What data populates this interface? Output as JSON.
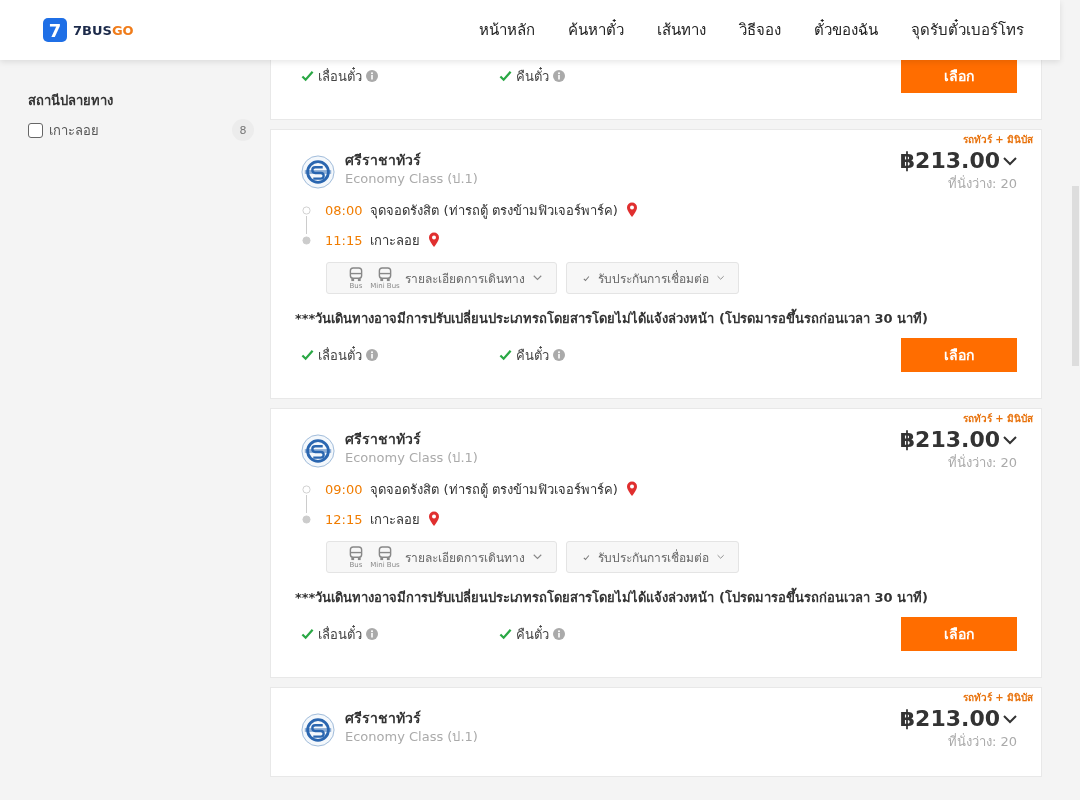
{
  "header": {
    "logo": {
      "mark": "7",
      "brand": "7BUS",
      "brand_accent": "GO"
    },
    "nav": [
      "หน้าหลัก",
      "ค้นหาตั๋ว",
      "เส้นทาง",
      "วิธีจอง",
      "ตั๋วของฉัน",
      "จุดรับตั๋วเบอร์โทร"
    ]
  },
  "sidebar": {
    "section_title": "สถานีปลายทาง",
    "filters": [
      {
        "label": "เกาะลอย",
        "count": "8",
        "checked": false
      }
    ]
  },
  "results": [
    {
      "kind": "foot_only",
      "features": [
        {
          "label": "เลื่อนตั๋ว",
          "available": true
        },
        {
          "label": "คืนตั๋ว",
          "available": true
        }
      ],
      "button": "เลือก"
    },
    {
      "kind": "full",
      "tag": "รถทัวร์ + มินิบัส",
      "operator": "ศรีราชาทัวร์",
      "class": "Economy Class (ป.1)",
      "price": "฿213.00",
      "seats": "ที่นั่งว่าง: 20",
      "stops": [
        {
          "time": "08:00",
          "place": "จุดจอดรังสิต (ท่ารถตู้ ตรงข้ามฟิวเจอร์พาร์ค)"
        },
        {
          "time": "11:15",
          "place": "เกาะลอย"
        }
      ],
      "vehicles": [
        "Bus",
        "Mini Bus"
      ],
      "details_label": "รายละเอียดการเดินทาง",
      "insurance_label": "รับประกันการเชื่อมต่อ",
      "notice": "***วันเดินทางอาจมีการปรับเปลี่ยนประเภทรถโดยสารโดยไม่ได้แจ้งล่วงหน้า (โปรดมารอขึ้นรถก่อนเวลา 30 นาที)",
      "features": [
        {
          "label": "เลื่อนตั๋ว",
          "available": true
        },
        {
          "label": "คืนตั๋ว",
          "available": true
        }
      ],
      "button": "เลือก"
    },
    {
      "kind": "full",
      "tag": "รถทัวร์ + มินิบัส",
      "operator": "ศรีราชาทัวร์",
      "class": "Economy Class (ป.1)",
      "price": "฿213.00",
      "seats": "ที่นั่งว่าง: 20",
      "stops": [
        {
          "time": "09:00",
          "place": "จุดจอดรังสิต (ท่ารถตู้ ตรงข้ามฟิวเจอร์พาร์ค)"
        },
        {
          "time": "12:15",
          "place": "เกาะลอย"
        }
      ],
      "vehicles": [
        "Bus",
        "Mini Bus"
      ],
      "details_label": "รายละเอียดการเดินทาง",
      "insurance_label": "รับประกันการเชื่อมต่อ",
      "notice": "***วันเดินทางอาจมีการปรับเปลี่ยนประเภทรถโดยสารโดยไม่ได้แจ้งล่วงหน้า (โปรดมารอขึ้นรถก่อนเวลา 30 นาที)",
      "features": [
        {
          "label": "เลื่อนตั๋ว",
          "available": true
        },
        {
          "label": "คืนตั๋ว",
          "available": true
        }
      ],
      "button": "เลือก"
    },
    {
      "kind": "head_only",
      "tag": "รถทัวร์ + มินิบัส",
      "operator": "ศรีราชาทัวร์",
      "class": "Economy Class (ป.1)",
      "price": "฿213.00",
      "seats": "ที่นั่งว่าง: 20"
    }
  ]
}
